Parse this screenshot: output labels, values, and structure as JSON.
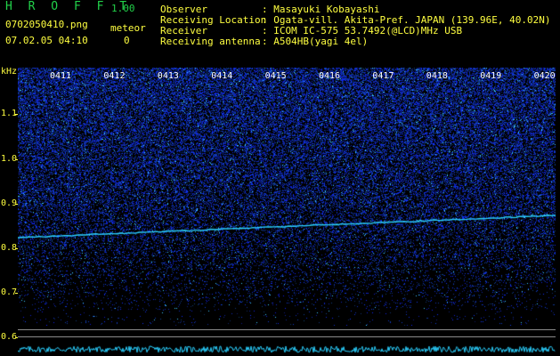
{
  "header": {
    "app_name": "H R O F F T",
    "version": "1.00",
    "filename": "0702050410.png",
    "timestamp": "07.02.05 04:10",
    "meteor_label": "meteor",
    "meteor_count": "0",
    "observer_label": "Observer",
    "observer_value": ": Masayuki Kobayashi",
    "location_label": "Receiving Location",
    "location_value": ": Ogata-vill. Akita-Pref. JAPAN (139.96E, 40.02N)",
    "receiver_label": "Receiver",
    "receiver_value": ": ICOM IC-575 53.7492(@LCD)MHz USB",
    "antenna_label": "Receiving antenna",
    "antenna_value": ": A504HB(yagi 4el)"
  },
  "axis": {
    "unit": "kHz",
    "ticks": [
      "1.1",
      "1.0",
      "0.9",
      "0.8",
      "0.7",
      "0.6"
    ]
  },
  "time_labels": [
    "0411",
    "0412",
    "0413",
    "0414",
    "0415",
    "0416",
    "0417",
    "0418",
    "0419",
    "0420"
  ],
  "colors": {
    "label": "#ffff40",
    "logo": "#22d24a",
    "noise": "#1a2bd8",
    "trace": "#2ad0ff"
  }
}
